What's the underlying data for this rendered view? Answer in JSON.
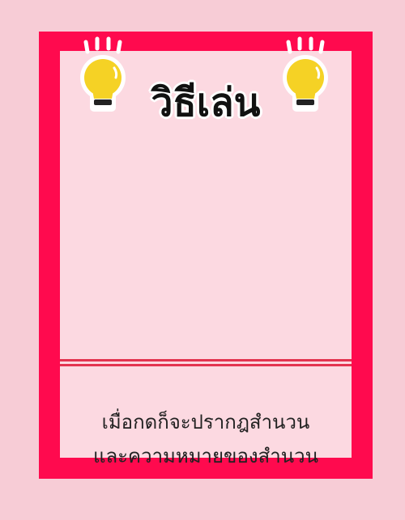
{
  "title": "วิธีเล่น",
  "description": {
    "line1": "เมื่อกดก็จะปรากฎสำนวน",
    "line2": "และความหมายของสำนวน"
  },
  "colors": {
    "background": "#f7ccd6",
    "frame": "#ff0a4e",
    "panel": "#fcd9e1",
    "divider": "#e3334f",
    "bulb": "#f5d225"
  },
  "icons": [
    "lightbulb-icon-left",
    "lightbulb-icon-right"
  ]
}
